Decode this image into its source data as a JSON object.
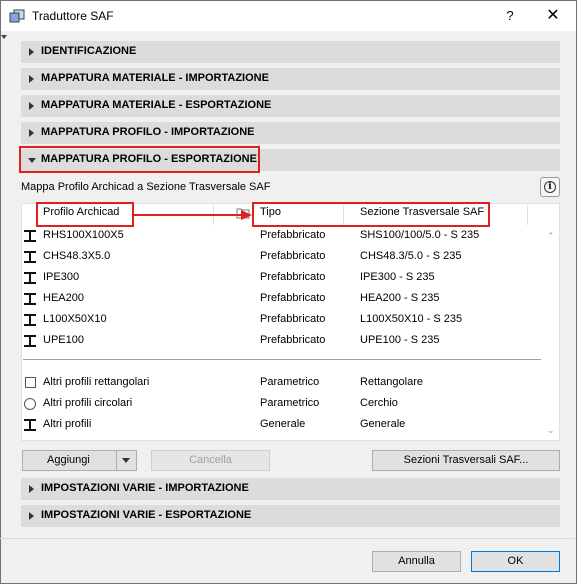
{
  "window": {
    "title": "Traduttore SAF",
    "help": "?",
    "close": "✕"
  },
  "sections": {
    "identificazione": "IDENTIFICAZIONE",
    "mat_import": "MAPPATURA MATERIALE - IMPORTAZIONE",
    "mat_export": "MAPPATURA MATERIALE - ESPORTAZIONE",
    "prof_import": "MAPPATURA PROFILO - IMPORTAZIONE",
    "prof_export": "MAPPATURA PROFILO - ESPORTAZIONE",
    "varie_import": "IMPOSTAZIONI VARIE - IMPORTAZIONE",
    "varie_export": "IMPOSTAZIONI VARIE - ESPORTAZIONE"
  },
  "panel": {
    "description": "Mappa Profilo Archicad a Sezione Trasversale SAF",
    "columns": [
      "Profilo Archicad",
      "Tipo",
      "Sezione Trasversale SAF"
    ],
    "rows": [
      {
        "profile": "RHS100X100X5",
        "type": "Prefabbricato",
        "section": "SHS100/100/5.0 - S 235",
        "icon": "i-beam-icon"
      },
      {
        "profile": "CHS48.3X5.0",
        "type": "Prefabbricato",
        "section": "CHS48.3/5.0 - S 235",
        "icon": "i-beam-icon"
      },
      {
        "profile": "IPE300",
        "type": "Prefabbricato",
        "section": "IPE300 - S 235",
        "icon": "i-beam-icon"
      },
      {
        "profile": "HEA200",
        "type": "Prefabbricato",
        "section": "HEA200 - S 235",
        "icon": "i-beam-icon"
      },
      {
        "profile": "L100X50X10",
        "type": "Prefabbricato",
        "section": "L100X50X10 - S 235",
        "icon": "i-beam-icon"
      },
      {
        "profile": "UPE100",
        "type": "Prefabbricato",
        "section": "UPE100 - S 235",
        "icon": "i-beam-icon"
      }
    ],
    "generic_rows": [
      {
        "profile": "Altri profili rettangolari",
        "type": "Parametrico",
        "section": "Rettangolare",
        "icon": "rectangle-icon"
      },
      {
        "profile": "Altri profili circolari",
        "type": "Parametrico",
        "section": "Cerchio",
        "icon": "circle-icon"
      },
      {
        "profile": "Altri profili",
        "type": "Generale",
        "section": "Generale",
        "icon": "i-beam-icon"
      }
    ]
  },
  "buttons": {
    "add": "Aggiungi",
    "delete": "Cancella",
    "saf_sections": "Sezioni Trasversali SAF...",
    "cancel": "Annulla",
    "ok": "OK"
  },
  "colors": {
    "highlight": "#e02020",
    "section_bg": "#dcdcdc",
    "ok_border": "#0078d7"
  }
}
